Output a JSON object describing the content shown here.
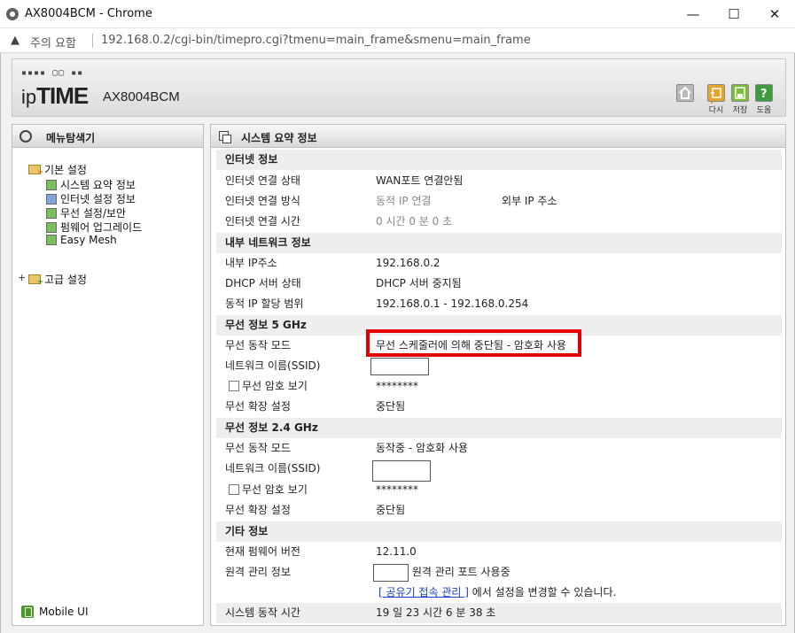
{
  "window": {
    "title": "AX8004BCM - Chrome",
    "minimize": "—",
    "maximize": "☐",
    "close": "✕"
  },
  "address": {
    "warning": "주의 요함",
    "url": "192.168.0.2/cgi-bin/timepro.cgi?tmenu=main_frame&smenu=main_frame"
  },
  "header": {
    "brand_prefix": "ip",
    "brand_bold": "TIME",
    "model": "AX8004BCM",
    "buttons": {
      "home": "",
      "refresh": "다시",
      "save": "저장",
      "help": "도움"
    }
  },
  "sidebar": {
    "title": "메뉴탐색기",
    "basic": "기본 설정",
    "items": [
      "시스템 요약 정보",
      "인터넷 설정 정보",
      "무선 설정/보안",
      "펌웨어 업그레이드",
      "Easy Mesh"
    ],
    "advanced": "고급 설정",
    "mobile": "Mobile UI"
  },
  "main": {
    "title": "시스템 요약 정보",
    "internet": {
      "section": "인터넷 정보",
      "status_k": "인터넷 연결 상태",
      "status_v": "WAN포트 연결안됨",
      "method_k": "인터넷 연결 방식",
      "method_v": "동적 IP 연결",
      "ext_ip": "외부 IP 주소",
      "time_k": "인터넷 연결 시간",
      "time_v": "0 시간 0 분 0 초"
    },
    "lan": {
      "section": "내부 네트워크 정보",
      "ip_k": "내부 IP주소",
      "ip_v": "192.168.0.2",
      "dhcp_k": "DHCP 서버 상태",
      "dhcp_v": "DHCP 서버 중지됨",
      "range_k": "동적 IP 할당 범위",
      "range_v": "192.168.0.1 -  192.168.0.254"
    },
    "w5": {
      "section": "무선 정보 5 GHz",
      "mode_k": "무선 동작 모드",
      "mode_v": "무선 스케줄러에 의해 중단됨 - 암호화 사용",
      "ssid_k": "네트워크 이름(SSID)",
      "pw_k": "무선 암호 보기",
      "pw_v": "********",
      "ext_k": "무선 확장 설정",
      "ext_v": "중단됨"
    },
    "w24": {
      "section": "무선 정보 2.4 GHz",
      "mode_k": "무선 동작 모드",
      "mode_v": "동작중 - 암호화 사용",
      "ssid_k": "네트워크 이름(SSID)",
      "pw_k": "무선 암호 보기",
      "pw_v": "********",
      "ext_k": "무선 확장 설정",
      "ext_v": "중단됨"
    },
    "etc": {
      "section": "기타 정보",
      "fw_k": "현재 펌웨어 버전",
      "fw_v": "12.11.0",
      "remote_k": "원격 관리 정보",
      "remote_v": "원격 관리 포트 사용중",
      "link": "[ 공유기 접속 관리 ]",
      "link_suffix": " 에서 설정을 변경할 수 있습니다.",
      "uptime_k": "시스템 동작 시간",
      "uptime_v": "19 일 23 시간 6 분 38 초"
    }
  },
  "colors": {
    "highlight": "#e30000",
    "link": "#1a3fbf"
  }
}
